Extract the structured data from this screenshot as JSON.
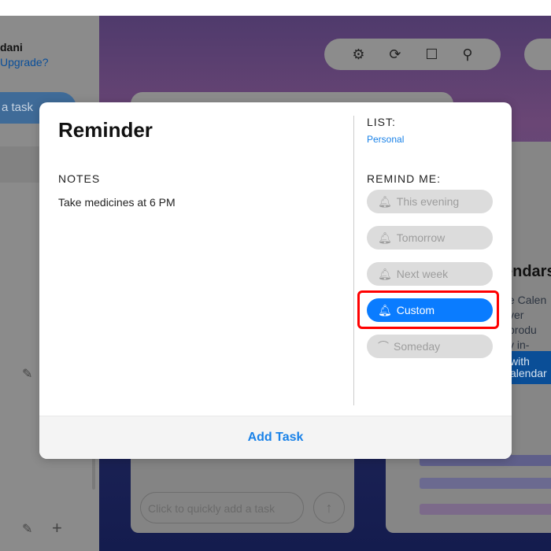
{
  "background": {
    "sidebar": {
      "user_name": "dani",
      "upgrade_link": "Upgrade?",
      "add_task": "a task"
    },
    "toolbar": {
      "icons": [
        "gear-icon",
        "sync-icon",
        "square-icon",
        "search-icon"
      ]
    },
    "quick_add": {
      "placeholder": "Click to quickly add a task"
    },
    "calendar_promo": {
      "title": "endars",
      "text": [
        "e Calen",
        "ver produ",
        "y in-sync"
      ],
      "button": "with\nalendar"
    }
  },
  "modal": {
    "title": "Reminder",
    "notes_label": "NOTES",
    "notes_value": "Take medicines at 6 PM",
    "list_label": "LIST:",
    "list_value": "Personal",
    "remind_label": "REMIND ME:",
    "options": [
      {
        "label": "This evening",
        "icon": "bell-icon",
        "selected": false
      },
      {
        "label": "Tomorrow",
        "icon": "bell-icon",
        "selected": false
      },
      {
        "label": "Next week",
        "icon": "bell-icon",
        "selected": false
      },
      {
        "label": "Custom",
        "icon": "bell-ringing-icon",
        "selected": true
      },
      {
        "label": "Someday",
        "icon": "rainbow-icon",
        "selected": false
      }
    ],
    "add_task": "Add Task"
  },
  "colors": {
    "accent": "#0a7cff",
    "highlight": "#ff0000"
  }
}
